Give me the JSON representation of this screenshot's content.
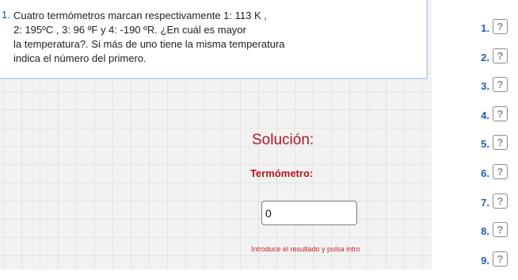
{
  "question": {
    "number": "1.",
    "text": "Cuatro termómetros marcan respectivamente 1:   113 K ,\n2:   195ºC , 3:   96 ºF y 4:   -190  ºR. ¿En cuál es mayor\nla temperatura?.  Si más de uno tiene la misma temperatura\nindica el número del primero."
  },
  "solution": {
    "title": "Solución:",
    "field_label": "Termómetro:",
    "input_value": "0",
    "hint": "Introduce el resultado y pulsa intro"
  },
  "question_list": [
    {
      "label": "1.",
      "status": "?"
    },
    {
      "label": "2.",
      "status": "?"
    },
    {
      "label": "3.",
      "status": "?"
    },
    {
      "label": "4.",
      "status": "?"
    },
    {
      "label": "5.",
      "status": "?"
    },
    {
      "label": "6.",
      "status": "?"
    },
    {
      "label": "7.",
      "status": "?"
    },
    {
      "label": "8.",
      "status": "?"
    },
    {
      "label": "9.",
      "status": "?"
    }
  ],
  "colors": {
    "accent_red": "#b3161b",
    "link_blue": "#1f5fbf"
  }
}
